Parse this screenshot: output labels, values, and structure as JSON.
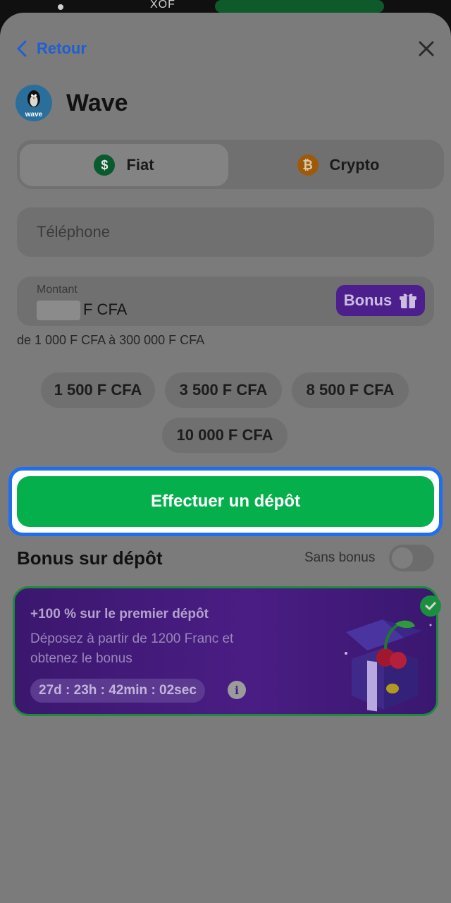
{
  "status_bar": {
    "currency": "XOF"
  },
  "header": {
    "back_label": "Retour"
  },
  "payment_method": {
    "name": "Wave",
    "logo_text": "wave"
  },
  "tabs": [
    {
      "label": "Fiat",
      "icon": "dollar-coin-icon",
      "icon_glyph": "$",
      "active": true
    },
    {
      "label": "Crypto",
      "icon": "bitcoin-icon",
      "icon_glyph": "₿",
      "active": false
    }
  ],
  "form": {
    "phone_placeholder": "Téléphone",
    "amount_label": "Montant",
    "amount_currency": "F CFA",
    "bonus_button": "Bonus",
    "range_text": "de 1 000 F CFA à 300 000 F CFA"
  },
  "quick_amounts": [
    "1 500 F CFA",
    "3 500 F CFA",
    "8 500 F CFA",
    "10 000 F CFA"
  ],
  "submit_label": "Effectuer un dépôt",
  "bonus_section": {
    "title": "Bonus sur dépôt",
    "toggle_label": "Sans bonus",
    "toggle_on": false,
    "promo": {
      "title": "+100 % sur le premier dépôt",
      "description": "Déposez à partir de 1200 Franc et obtenez le bonus",
      "timer": "27d : 23h : 42min : 02sec",
      "selected": true
    }
  },
  "colors": {
    "accent_green": "#05b04c",
    "link_blue": "#1f5fd1",
    "focus_blue": "#1e6ff0",
    "promo_purple": "#4a1d84"
  }
}
